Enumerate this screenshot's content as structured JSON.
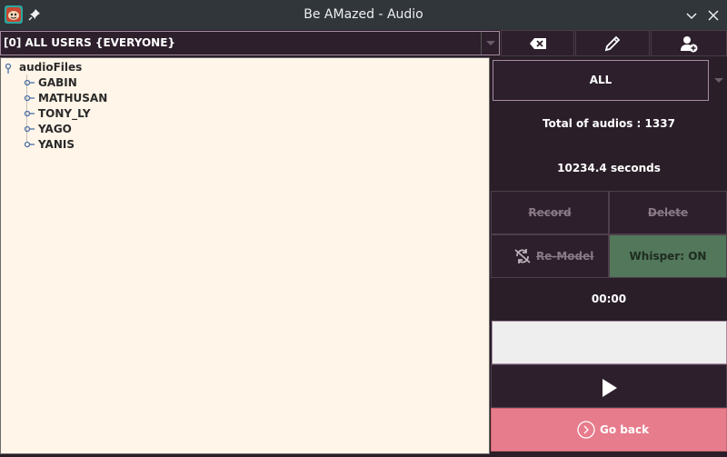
{
  "window": {
    "title": "Be AMazed - Audio"
  },
  "toolbar": {
    "user_select_value": "[0] ALL USERS {EVERYONE}"
  },
  "tree": {
    "root": "audioFiles",
    "children": [
      "GABIN",
      "MATHUSAN",
      "TONY_LY",
      "YAGO",
      "YANIS"
    ]
  },
  "panel": {
    "filter_value": "ALL",
    "total_audios": "Total of audios : 1337",
    "total_seconds": "10234.4 seconds",
    "record_label": "Record",
    "delete_label": "Delete",
    "remodel_label": "Re-Model",
    "whisper_label": "Whisper: ON",
    "time": "00:00",
    "goback_label": "Go back"
  },
  "colors": {
    "background": "#2a1e28",
    "tree_background": "#fff5e8",
    "whisper_on": "#52775a",
    "go_back": "#e77c8c"
  }
}
